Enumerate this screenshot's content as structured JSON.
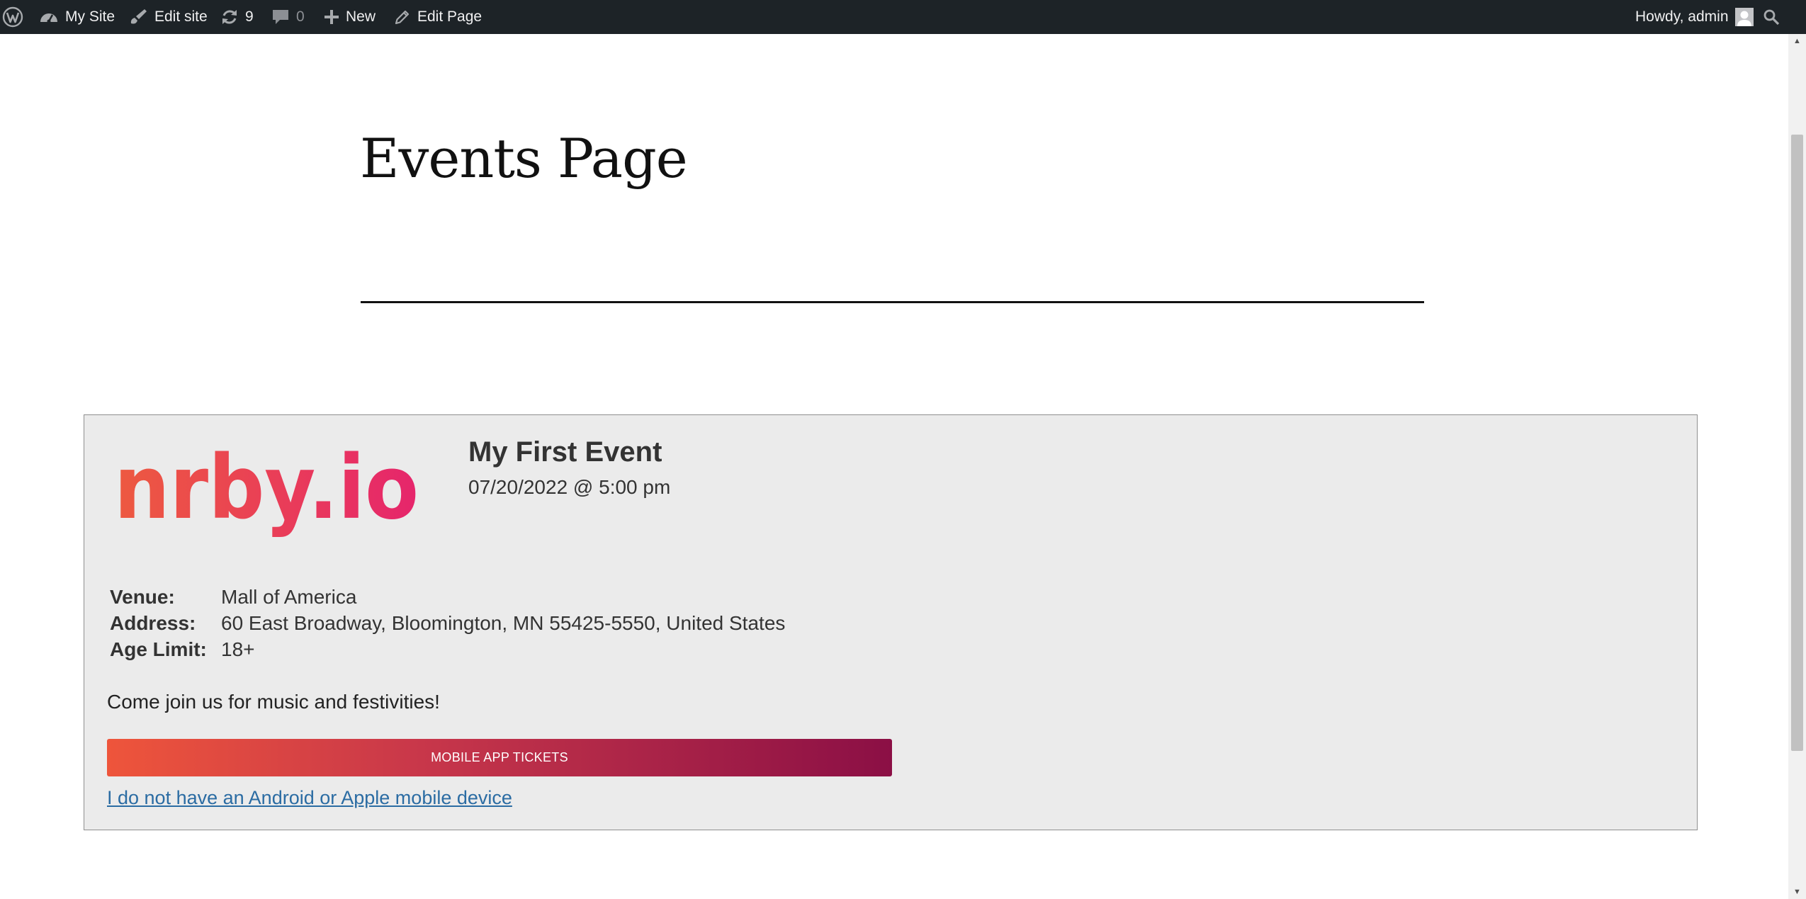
{
  "admin_bar": {
    "site_name": "My Site",
    "edit_site": "Edit site",
    "updates_count": "9",
    "comments_count": "0",
    "new_label": "New",
    "edit_page": "Edit Page",
    "greeting": "Howdy, admin"
  },
  "page": {
    "title": "Events Page"
  },
  "event": {
    "logo_text": "nrby.io",
    "title": "My First Event",
    "datetime": "07/20/2022 @ 5:00 pm",
    "details": [
      {
        "label": "Venue:",
        "value": "Mall of America"
      },
      {
        "label": "Address:",
        "value": "60 East Broadway, Bloomington, MN 55425-5550, United States"
      },
      {
        "label": "Age Limit:",
        "value": "18+"
      }
    ],
    "description": "Come join us for music and festivities!",
    "tickets_button": "MOBILE APP TICKETS",
    "no_device_link": "I do not have an Android or Apple mobile device"
  },
  "colors": {
    "admin_bar_bg": "#1d2327",
    "card_bg": "#ebebeb",
    "button_gradient_start": "#ee553b",
    "button_gradient_end": "#8b0f45",
    "link": "#2b6ca3"
  },
  "icons": [
    "wordpress-logo-icon",
    "dashboard-icon",
    "brush-icon",
    "updates-icon",
    "comment-icon",
    "plus-icon",
    "pencil-icon",
    "avatar-icon",
    "search-icon"
  ]
}
